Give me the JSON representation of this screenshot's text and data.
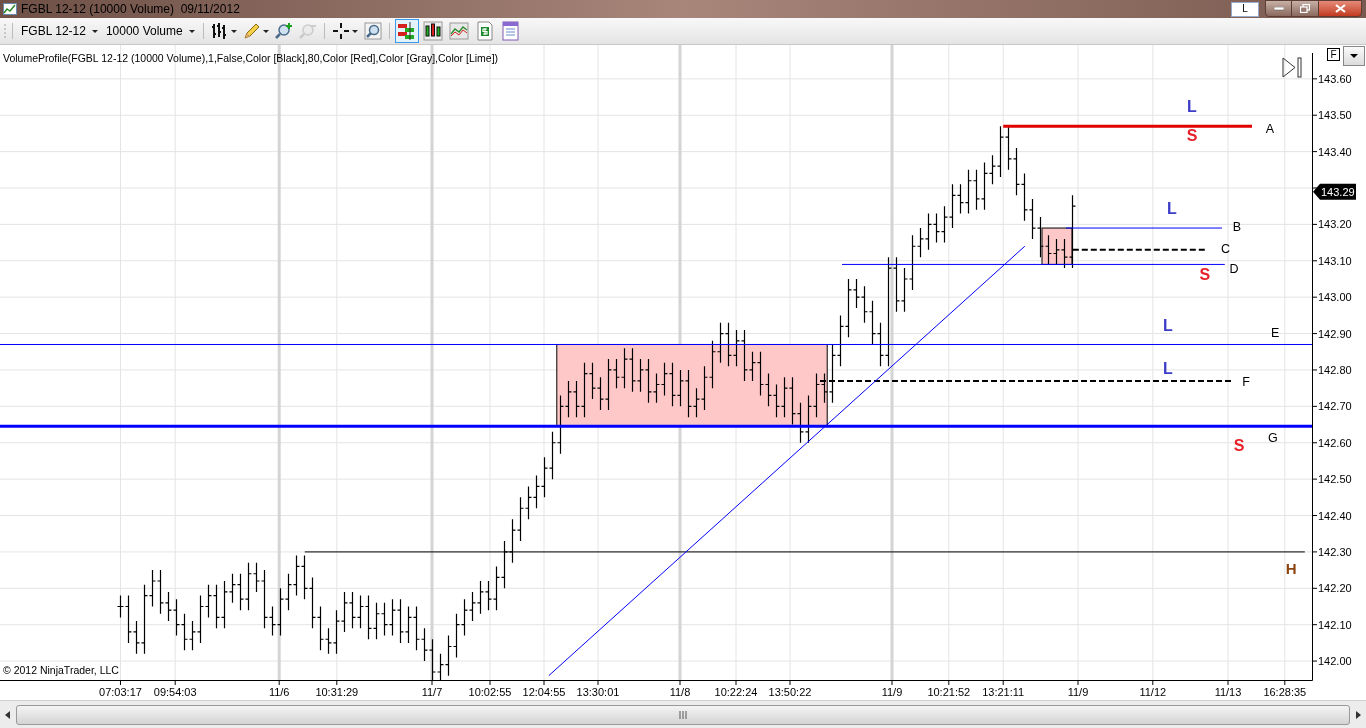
{
  "window": {
    "title": "FGBL 12-12 (10000 Volume)  09/11/2012",
    "badge": "L"
  },
  "toolbar": {
    "instrument": "FGBL 12-12",
    "interval": "10000 Volume",
    "tools": [
      {
        "kind": "bar-style",
        "menu": true,
        "disabled": false
      },
      {
        "kind": "pencil",
        "menu": true,
        "disabled": false
      },
      {
        "kind": "zoom-in",
        "menu": false,
        "disabled": false
      },
      {
        "kind": "zoom-out",
        "menu": false,
        "disabled": true
      },
      {
        "kind": "crosshair",
        "menu": true,
        "disabled": false
      },
      {
        "kind": "magnifier",
        "menu": false,
        "disabled": false
      }
    ],
    "view_buttons": [
      {
        "kind": "bars",
        "selected": true
      },
      {
        "kind": "candles",
        "selected": false
      },
      {
        "kind": "line-chart",
        "selected": false
      },
      {
        "kind": "dollar",
        "selected": false
      },
      {
        "kind": "data-box",
        "selected": false
      }
    ]
  },
  "chart": {
    "indicator_label": "VolumeProfile(FGBL 12-12 (10000 Volume),1,False,Color [Black],80,Color [Red],Color [Gray],Color [Lime])",
    "copyright": "© 2012 NinjaTrader, LLC",
    "scale_button": "F",
    "last_price": "143.29",
    "price_axis": [
      "143.60",
      "143.50",
      "143.40",
      "143.20",
      "143.10",
      "143.00",
      "142.90",
      "142.80",
      "142.70",
      "142.60",
      "142.50",
      "142.40",
      "142.30",
      "142.20",
      "142.10",
      "142.00"
    ],
    "time_axis": [
      "07:03:17",
      "09:54:03",
      "11/6",
      "10:31:29",
      "11/7",
      "10:02:55",
      "12:04:55",
      "13:30:01",
      "11/8",
      "10:22:24",
      "13:50:22",
      "11/9",
      "10:21:52",
      "13:21:11",
      "11/9",
      "11/12",
      "11/13",
      "16:28:35"
    ],
    "line_labels": [
      {
        "text": "A",
        "color": "#000000"
      },
      {
        "text": "B",
        "color": "#000000"
      },
      {
        "text": "C",
        "color": "#000000"
      },
      {
        "text": "D",
        "color": "#000000"
      },
      {
        "text": "E",
        "color": "#000000"
      },
      {
        "text": "F",
        "color": "#000000"
      },
      {
        "text": "G",
        "color": "#000000"
      },
      {
        "text": "H",
        "color": "#8b4513"
      }
    ],
    "signals": [
      {
        "text": "L",
        "color": "#3c3cc8"
      },
      {
        "text": "S",
        "color": "#e8202a"
      },
      {
        "text": "L",
        "color": "#3c3cc8"
      },
      {
        "text": "S",
        "color": "#e8202a"
      },
      {
        "text": "L",
        "color": "#3c3cc8"
      },
      {
        "text": "L",
        "color": "#3c3cc8"
      },
      {
        "text": "S",
        "color": "#e8202a"
      }
    ]
  }
}
